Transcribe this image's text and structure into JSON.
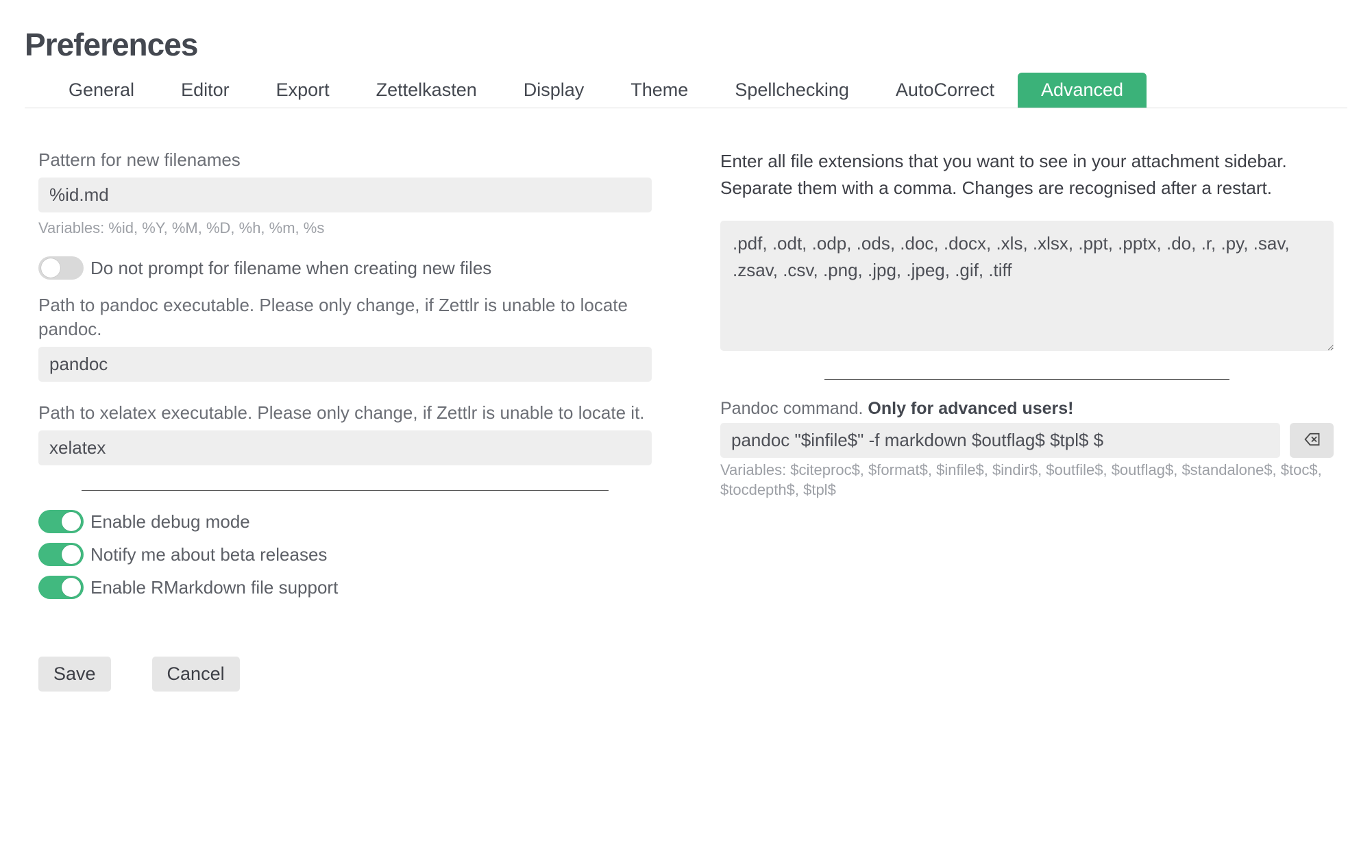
{
  "title": "Preferences",
  "tabs": {
    "items": [
      "General",
      "Editor",
      "Export",
      "Zettelkasten",
      "Display",
      "Theme",
      "Spellchecking",
      "AutoCorrect",
      "Advanced"
    ],
    "active": 8
  },
  "left": {
    "pattern_label": "Pattern for new filenames",
    "pattern_value": "%id.md",
    "pattern_hint": "Variables: %id, %Y, %M, %D, %h, %m, %s",
    "no_prompt": {
      "on": false,
      "label": "Do not prompt for filename when creating new files"
    },
    "pandoc_label": "Path to pandoc executable. Please only change, if Zettlr is unable to locate pandoc.",
    "pandoc_value": "pandoc",
    "xelatex_label": "Path to xelatex executable. Please only change, if Zettlr is unable to locate it.",
    "xelatex_value": "xelatex",
    "debug": {
      "on": true,
      "label": "Enable debug mode"
    },
    "beta": {
      "on": true,
      "label": "Notify me about beta releases"
    },
    "rmd": {
      "on": true,
      "label": "Enable RMarkdown file support"
    }
  },
  "right": {
    "ext_desc": "Enter all file extensions that you want to see in your attachment sidebar. Separate them with a comma. Changes are recognised after a restart.",
    "ext_value": ".pdf, .odt, .odp, .ods, .doc, .docx, .xls, .xlsx, .ppt, .pptx, .do, .r, .py, .sav, .zsav, .csv, .png, .jpg, .jpeg, .gif, .tiff",
    "cmd_label_plain": "Pandoc command. ",
    "cmd_label_bold": "Only for advanced users!",
    "cmd_value": "pandoc \"$infile$\" -f markdown $outflag$ $tpl$ $",
    "cmd_hint": "Variables: $citeproc$, $format$, $infile$, $indir$, $outfile$, $outflag$, $standalone$, $toc$, $tocdepth$, $tpl$"
  },
  "buttons": {
    "save": "Save",
    "cancel": "Cancel"
  }
}
